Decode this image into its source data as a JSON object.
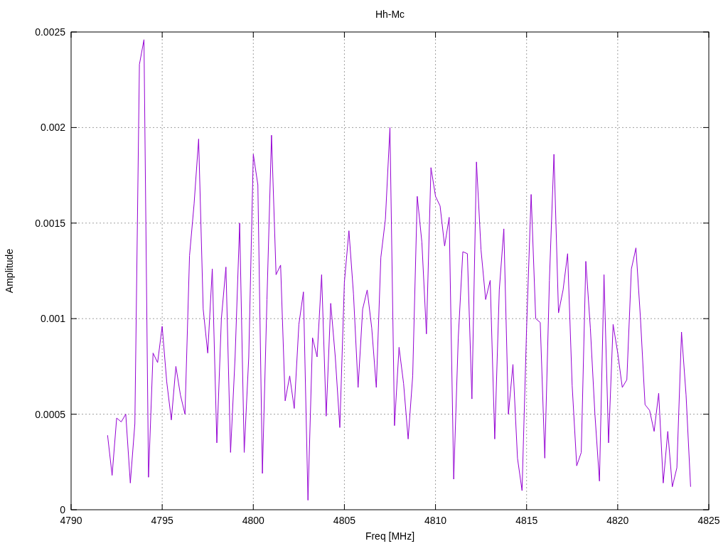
{
  "chart_data": {
    "type": "line",
    "title": "Hh-Mc",
    "grid": true,
    "xlabel": "Freq [MHz]",
    "ylabel": "Amplitude",
    "xlim": [
      4790,
      4825
    ],
    "ylim": [
      0,
      0.0025
    ],
    "xticks": [
      4790,
      4795,
      4800,
      4805,
      4810,
      4815,
      4820,
      4825
    ],
    "yticks": [
      0,
      0.0005,
      0.001,
      0.0015,
      0.002,
      0.0025
    ],
    "x": [
      4792,
      4792.25,
      4792.5,
      4792.75,
      4793,
      4793.25,
      4793.5,
      4793.75,
      4794,
      4794.25,
      4794.5,
      4794.75,
      4795,
      4795.25,
      4795.5,
      4795.75,
      4796,
      4796.25,
      4796.5,
      4796.75,
      4797,
      4797.25,
      4797.5,
      4797.75,
      4798,
      4798.25,
      4798.5,
      4798.75,
      4799,
      4799.25,
      4799.5,
      4799.75,
      4800,
      4800.25,
      4800.5,
      4800.75,
      4801,
      4801.25,
      4801.5,
      4801.75,
      4802,
      4802.25,
      4802.5,
      4802.75,
      4803,
      4803.25,
      4803.5,
      4803.75,
      4804,
      4804.25,
      4804.5,
      4804.75,
      4805,
      4805.25,
      4805.5,
      4805.75,
      4806,
      4806.25,
      4806.5,
      4806.75,
      4807,
      4807.25,
      4807.5,
      4807.75,
      4808,
      4808.25,
      4808.5,
      4808.75,
      4809,
      4809.25,
      4809.5,
      4809.75,
      4810,
      4810.25,
      4810.5,
      4810.75,
      4811,
      4811.25,
      4811.5,
      4811.75,
      4812,
      4812.25,
      4812.5,
      4812.75,
      4813,
      4813.25,
      4813.5,
      4813.75,
      4814,
      4814.25,
      4814.5,
      4814.75,
      4815,
      4815.25,
      4815.5,
      4815.75,
      4816,
      4816.25,
      4816.5,
      4816.75,
      4817,
      4817.25,
      4817.5,
      4817.75,
      4818,
      4818.25,
      4818.5,
      4818.75,
      4819,
      4819.25,
      4819.5,
      4819.75,
      4820,
      4820.25,
      4820.5,
      4820.75,
      4821,
      4821.25,
      4821.5,
      4821.75,
      4822,
      4822.25,
      4822.5,
      4822.75,
      4823,
      4823.25,
      4823.5,
      4823.75,
      4824
    ],
    "series": [
      {
        "color": "#9400d3",
        "values": [
          0.00039,
          0.00018,
          0.00048,
          0.00046,
          0.0005,
          0.00014,
          0.00045,
          0.00233,
          0.00246,
          0.00017,
          0.00082,
          0.00077,
          0.00096,
          0.00067,
          0.00047,
          0.00075,
          0.0006,
          0.0005,
          0.00133,
          0.0016,
          0.00194,
          0.00105,
          0.00082,
          0.00126,
          0.00035,
          0.001,
          0.00127,
          0.0003,
          0.0008,
          0.0015,
          0.0003,
          0.0008,
          0.00186,
          0.0017,
          0.00019,
          0.0011,
          0.00196,
          0.00123,
          0.00128,
          0.00057,
          0.0007,
          0.00053,
          0.00097,
          0.00114,
          5e-05,
          0.0009,
          0.0008,
          0.00123,
          0.00049,
          0.00108,
          0.0008,
          0.00043,
          0.00119,
          0.00146,
          0.00113,
          0.00064,
          0.00105,
          0.00115,
          0.00095,
          0.00064,
          0.00132,
          0.00152,
          0.002,
          0.00044,
          0.00085,
          0.00066,
          0.00037,
          0.0007,
          0.00164,
          0.0014,
          0.00092,
          0.00179,
          0.00164,
          0.00159,
          0.00138,
          0.00153,
          0.00016,
          0.0009,
          0.00135,
          0.00134,
          0.00058,
          0.00182,
          0.00136,
          0.0011,
          0.0012,
          0.00037,
          0.00115,
          0.00147,
          0.0005,
          0.00076,
          0.00027,
          0.0001,
          0.00095,
          0.00165,
          0.001,
          0.00098,
          0.00027,
          0.0012,
          0.00186,
          0.00103,
          0.00115,
          0.00134,
          0.00065,
          0.00023,
          0.0003,
          0.0013,
          0.00095,
          0.0005,
          0.00015,
          0.00123,
          0.00035,
          0.00097,
          0.00082,
          0.00064,
          0.00068,
          0.00126,
          0.00137,
          0.001,
          0.00055,
          0.00052,
          0.00041,
          0.00061,
          0.00014,
          0.00041,
          0.00012,
          0.00022,
          0.00093,
          0.0006,
          0.00012
        ]
      }
    ]
  }
}
